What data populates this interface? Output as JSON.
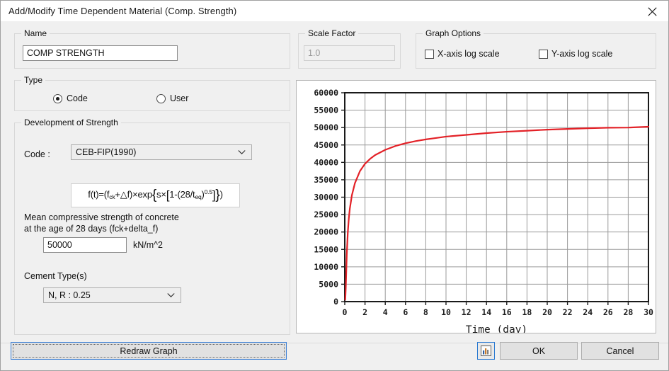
{
  "window": {
    "title": "Add/Modify Time Dependent Material (Comp. Strength)",
    "close_icon": "close-icon"
  },
  "name_group": {
    "legend": "Name",
    "value": "COMP STRENGTH",
    "placeholder": ""
  },
  "scale_factor_group": {
    "legend": "Scale Factor",
    "value": "1.0",
    "placeholder": ""
  },
  "graph_options_group": {
    "legend": "Graph Options",
    "x_log": {
      "label": "X-axis log scale",
      "checked": false
    },
    "y_log": {
      "label": "Y-axis log scale",
      "checked": false
    }
  },
  "type_group": {
    "legend": "Type",
    "code": {
      "label": "Code",
      "checked": true
    },
    "user": {
      "label": "User",
      "checked": false
    }
  },
  "development_group": {
    "legend": "Development of Strength",
    "code_label": "Code :",
    "code_value": "CEB-FIP(1990)",
    "formula_parts": {
      "lead": "f(t)=(f",
      "sub1": "ck",
      "mid1": "+△f)×exp",
      "mid2": "s×",
      "mid3": "1-(28/t",
      "sub2": "eq",
      "sup1": "0.5"
    },
    "strength_label_line1": "Mean compressive strength of concrete",
    "strength_label_line2": "at the age of 28 days (fck+delta_f)",
    "strength_value": "50000",
    "strength_unit": "kN/m^2",
    "cement_label": "Cement Type(s)",
    "cement_value": "N, R : 0.25"
  },
  "buttons": {
    "redraw": "Redraw Graph",
    "ok": "OK",
    "cancel": "Cancel",
    "chart_icon": "bar-chart-icon"
  },
  "colors": {
    "curve": "#e32127",
    "grid": "#9a9a9a",
    "axis": "#1a1a1a",
    "focus": "#2b7ad1",
    "panel": "#f0f0f0"
  },
  "chart_data": {
    "type": "line",
    "title": "",
    "xlabel": "Time  (day)",
    "ylabel": "",
    "xlim": [
      0,
      30
    ],
    "ylim": [
      0,
      60000
    ],
    "xticks": [
      0,
      2,
      4,
      6,
      8,
      10,
      12,
      14,
      16,
      18,
      20,
      22,
      24,
      26,
      28,
      30
    ],
    "yticks": [
      0,
      5000,
      10000,
      15000,
      20000,
      25000,
      30000,
      35000,
      40000,
      45000,
      50000,
      55000,
      60000
    ],
    "grid": true,
    "legend": "none",
    "series": [
      {
        "name": "Comp. Strength",
        "color": "#e32127",
        "x": [
          0.05,
          0.1,
          0.2,
          0.3,
          0.4,
          0.5,
          0.7,
          1,
          1.5,
          2,
          2.5,
          3,
          4,
          5,
          6,
          7,
          8,
          9,
          10,
          12,
          14,
          16,
          18,
          20,
          22,
          24,
          26,
          28,
          30
        ],
        "y": [
          550,
          4000,
          13600,
          19900,
          23900,
          26700,
          30500,
          34000,
          37500,
          39600,
          41000,
          42100,
          43600,
          44700,
          45500,
          46100,
          46600,
          47000,
          47400,
          47900,
          48400,
          48800,
          49100,
          49400,
          49600,
          49800,
          49950,
          50000,
          50240
        ]
      }
    ]
  }
}
